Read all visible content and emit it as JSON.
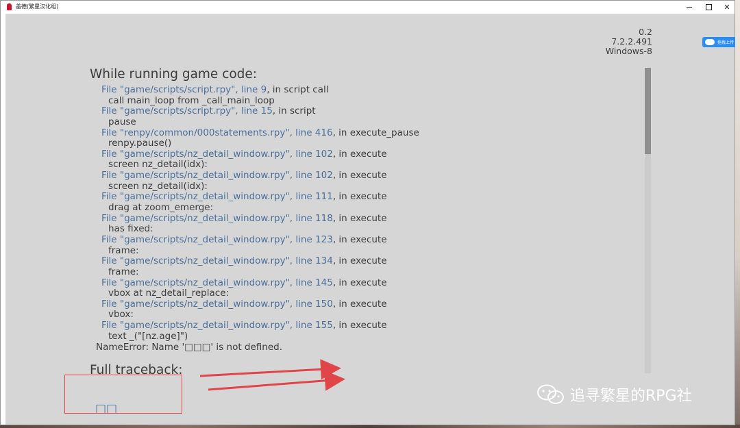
{
  "window": {
    "title": "盖德(繁星汉化组)",
    "controls": {
      "minimize": "—",
      "maximize": "☐",
      "close": "✕"
    }
  },
  "version": [
    "0.2",
    "7.2.2.491",
    "Windows-8"
  ],
  "traceback": {
    "heading": "While running game code:",
    "lines": [
      {
        "kind": "frame",
        "file": "File \"game/scripts/script.rpy\", line 9",
        "rest": ", in script call"
      },
      {
        "kind": "code",
        "text": "call main_loop from _call_main_loop"
      },
      {
        "kind": "frame",
        "file": "File \"game/scripts/script.rpy\", line 15",
        "rest": ", in script"
      },
      {
        "kind": "code",
        "text": "pause"
      },
      {
        "kind": "frame",
        "file": "File \"renpy/common/000statements.rpy\", line 416",
        "rest": ", in execute_pause"
      },
      {
        "kind": "code",
        "text": "renpy.pause()"
      },
      {
        "kind": "frame",
        "file": "File \"game/scripts/nz_detail_window.rpy\", line 102",
        "rest": ", in execute"
      },
      {
        "kind": "code",
        "text": "screen nz_detail(idx):"
      },
      {
        "kind": "frame",
        "file": "File \"game/scripts/nz_detail_window.rpy\", line 102",
        "rest": ", in execute"
      },
      {
        "kind": "code",
        "text": "screen nz_detail(idx):"
      },
      {
        "kind": "frame",
        "file": "File \"game/scripts/nz_detail_window.rpy\", line 111",
        "rest": ", in execute"
      },
      {
        "kind": "code",
        "text": "drag at zoom_emerge:"
      },
      {
        "kind": "frame",
        "file": "File \"game/scripts/nz_detail_window.rpy\", line 118",
        "rest": ", in execute"
      },
      {
        "kind": "code",
        "text": "has fixed:"
      },
      {
        "kind": "frame",
        "file": "File \"game/scripts/nz_detail_window.rpy\", line 123",
        "rest": ", in execute"
      },
      {
        "kind": "code",
        "text": "frame:"
      },
      {
        "kind": "frame",
        "file": "File \"game/scripts/nz_detail_window.rpy\", line 134",
        "rest": ", in execute"
      },
      {
        "kind": "code",
        "text": "frame:"
      },
      {
        "kind": "frame",
        "file": "File \"game/scripts/nz_detail_window.rpy\", line 145",
        "rest": ", in execute"
      },
      {
        "kind": "code",
        "text": "vbox at nz_detail_replace:"
      },
      {
        "kind": "frame",
        "file": "File \"game/scripts/nz_detail_window.rpy\", line 150",
        "rest": ", in execute"
      },
      {
        "kind": "code",
        "text": "vbox:"
      },
      {
        "kind": "frame",
        "file": "File \"game/scripts/nz_detail_window.rpy\", line 155",
        "rest": ", in execute"
      },
      {
        "kind": "code",
        "text": "text _(\"[nz.age]\")"
      }
    ],
    "error": "NameError: Name '□□□' is not defined.",
    "full_heading": "Full traceback:"
  },
  "back_link": "□□",
  "cloud_widget": {
    "label": "拖拽上传"
  },
  "watermark": "追寻繁星的RPG社",
  "colors": {
    "background": "#d6d6d6",
    "text": "#3c3c3c",
    "link": "#4a6f9a",
    "annotation": "#e0454a"
  },
  "icons": [
    "app-icon",
    "cloud-upload-icon",
    "wechat-icon"
  ]
}
